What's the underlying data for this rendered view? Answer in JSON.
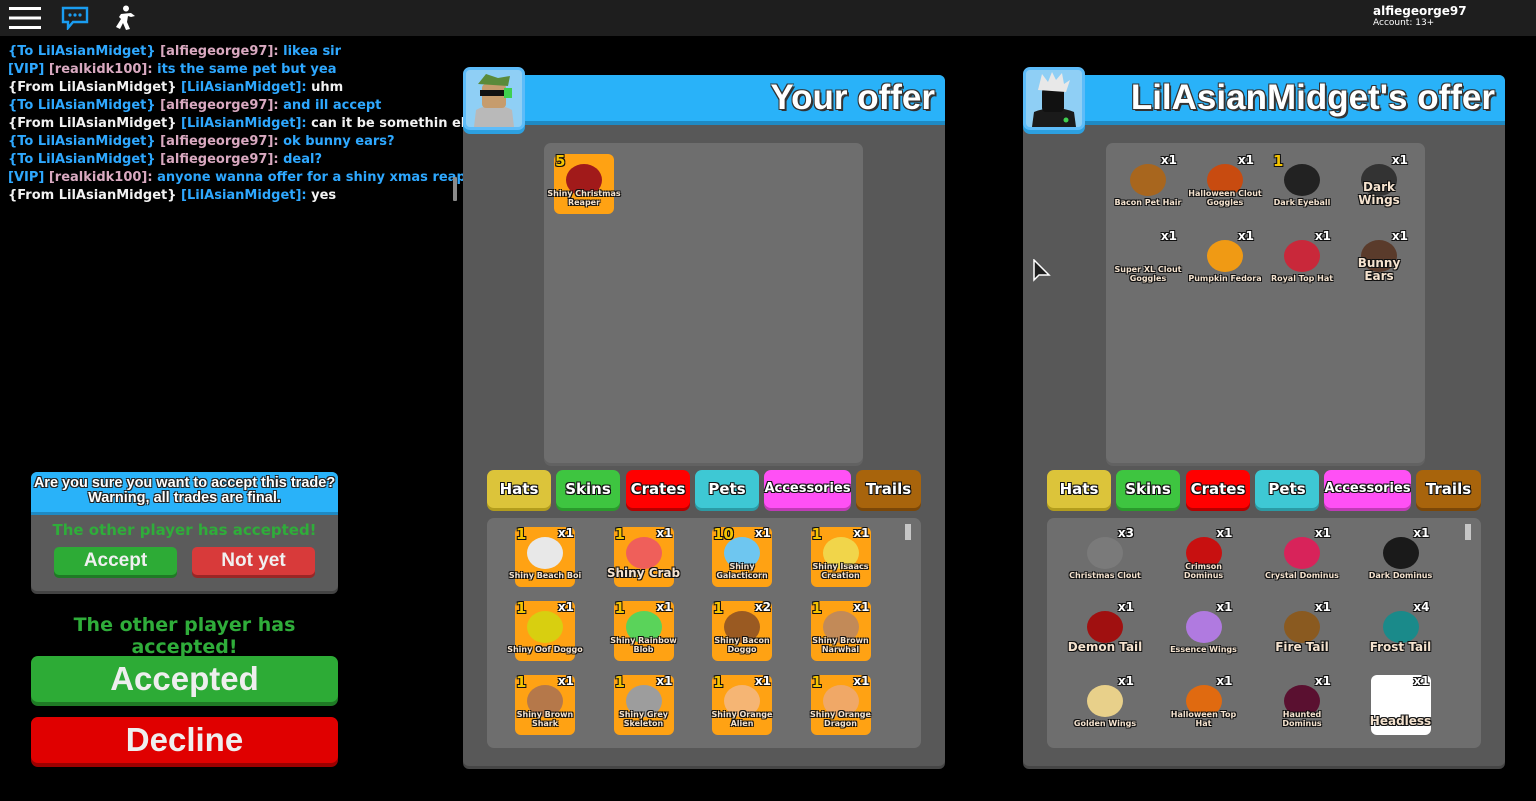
{
  "topbar": {
    "icons": [
      "menu-icon",
      "chat-icon",
      "emote-icon"
    ],
    "account_name": "alfiegeorge97",
    "account_age": "Account: 13+"
  },
  "chat": {
    "messages": [
      {
        "prefix": "{To LilAsianMidget}",
        "user": "[alfiegeorge97]:",
        "text": " likea sir",
        "prefix_color": "#2ea8ff",
        "user_color": "#d9a9c0",
        "text_color": "#2ea8ff"
      },
      {
        "prefix": "[VIP]",
        "user": "[realkidk100]:",
        "text": " its the same pet but yea",
        "prefix_color": "#2ea8ff",
        "user_color": "#d9a9c0",
        "text_color": "#2ea8ff"
      },
      {
        "prefix": "{From LilAsianMidget}",
        "user": "[LilAsianMidget]:",
        "text": "uhm",
        "prefix_color": "#f2f2f2",
        "user_color": "#2ea8ff",
        "text_color": "#f2f2f2"
      },
      {
        "prefix": "{To LilAsianMidget}",
        "user": "[alfiegeorge97]:",
        "text": " and ill accept",
        "prefix_color": "#2ea8ff",
        "user_color": "#d9a9c0",
        "text_color": "#2ea8ff"
      },
      {
        "prefix": "{From LilAsianMidget}",
        "user": "[LilAsianMidget]:",
        "text": "can it be somethin else",
        "prefix_color": "#f2f2f2",
        "user_color": "#2ea8ff",
        "text_color": "#f2f2f2"
      },
      {
        "prefix": "{To LilAsianMidget}",
        "user": "[alfiegeorge97]:",
        "text": " ok bunny ears?",
        "prefix_color": "#2ea8ff",
        "user_color": "#d9a9c0",
        "text_color": "#2ea8ff"
      },
      {
        "prefix": "{To LilAsianMidget}",
        "user": "[alfiegeorge97]:",
        "text": " deal?",
        "prefix_color": "#2ea8ff",
        "user_color": "#d9a9c0",
        "text_color": "#2ea8ff"
      },
      {
        "prefix": "[VIP]",
        "user": "[realkidk100]:",
        "text": " anyone wanna offer for a shiny xmas reaper",
        "prefix_color": "#2ea8ff",
        "user_color": "#d9a9c0",
        "text_color": "#2ea8ff"
      },
      {
        "prefix": "{From LilAsianMidget}",
        "user": "[LilAsianMidget]:",
        "text": "yes",
        "prefix_color": "#f2f2f2",
        "user_color": "#2ea8ff",
        "text_color": "#f2f2f2"
      }
    ]
  },
  "confirm": {
    "question": "Are you sure you want to accept this trade? Warning, all trades are final.",
    "status": "The other player has accepted!",
    "accept_label": "Accept",
    "notyet_label": "Not yet"
  },
  "trade": {
    "status": "The other player has accepted!",
    "accepted_label": "Accepted",
    "decline_label": "Decline"
  },
  "tabs": [
    "Hats",
    "Skins",
    "Crates",
    "Pets",
    "Accessories",
    "Trails"
  ],
  "your_offer": {
    "title": "Your offer",
    "items": [
      {
        "name": "Shiny Christmas Reaper",
        "level": "5",
        "qty": "",
        "bg": "orange",
        "art": "#a11a1a"
      }
    ],
    "inventory": [
      {
        "name": "Shiny Beach Boi",
        "level": "1",
        "qty": "x1",
        "art": "#e8e8e8"
      },
      {
        "name": "Shiny Crab",
        "level": "1",
        "qty": "x1",
        "art": "#ef5f5a",
        "big": true
      },
      {
        "name": "Shiny Galacticorn",
        "level": "10",
        "qty": "x1",
        "art": "#6ec6f0"
      },
      {
        "name": "Shiny Isaacs Creation",
        "level": "1",
        "qty": "x1",
        "art": "#f1d54a"
      },
      {
        "name": "Shiny Oof Doggo",
        "level": "1",
        "qty": "x1",
        "art": "#d8cf10"
      },
      {
        "name": "Shiny Rainbow Blob",
        "level": "1",
        "qty": "x1",
        "art": "#5ad35a"
      },
      {
        "name": "Shiny Bacon Doggo",
        "level": "1",
        "qty": "x2",
        "art": "#9a5a22"
      },
      {
        "name": "Shiny Brown Narwhal",
        "level": "1",
        "qty": "x1",
        "art": "#c28a58"
      },
      {
        "name": "Shiny Brown Shark",
        "level": "1",
        "qty": "x1",
        "art": "#b5784a"
      },
      {
        "name": "Shiny Grey Skeleton",
        "level": "1",
        "qty": "x1",
        "art": "#9d9d9d"
      },
      {
        "name": "Shiny Orange Alien",
        "level": "1",
        "qty": "x1",
        "art": "#f5b574"
      },
      {
        "name": "Shiny Orange Dragon",
        "level": "1",
        "qty": "x1",
        "art": "#f0a867"
      }
    ]
  },
  "their_offer": {
    "title": "LilAsianMidget's offer",
    "items": [
      {
        "name": "Bacon Pet Hair",
        "level": "",
        "qty": "x1",
        "art": "#a8661e"
      },
      {
        "name": "Halloween Clout Goggles",
        "level": "",
        "qty": "x1",
        "art": "#c84b10"
      },
      {
        "name": "Dark Eyeball",
        "level": "1",
        "qty": "",
        "art": "#222"
      },
      {
        "name": "Dark Wings",
        "level": "",
        "qty": "x1",
        "art": "#333",
        "big": true
      },
      {
        "name": "Super XL Clout Goggles",
        "level": "",
        "qty": "x1",
        "art": ""
      },
      {
        "name": "Pumpkin Fedora",
        "level": "",
        "qty": "x1",
        "art": "#f09a14"
      },
      {
        "name": "Royal Top Hat",
        "level": "",
        "qty": "x1",
        "art": "#c9283a"
      },
      {
        "name": "Bunny Ears",
        "level": "",
        "qty": "x1",
        "art": "#5a3b2b",
        "big": true
      }
    ],
    "inventory": [
      {
        "name": "Christmas Clout",
        "level": "",
        "qty": "x3",
        "art": "#7a7a7a"
      },
      {
        "name": "Crimson Dominus",
        "level": "",
        "qty": "x1",
        "art": "#c81010"
      },
      {
        "name": "Crystal Dominus",
        "level": "",
        "qty": "x1",
        "art": "#d8235a"
      },
      {
        "name": "Dark Dominus",
        "level": "",
        "qty": "x1",
        "art": "#1a1a1a"
      },
      {
        "name": "Demon Tail",
        "level": "",
        "qty": "x1",
        "art": "#a01010",
        "big": true
      },
      {
        "name": "Essence Wings",
        "level": "",
        "qty": "x1",
        "art": "#b07ae0"
      },
      {
        "name": "Fire Tail",
        "level": "",
        "qty": "x1",
        "art": "#8a5a20",
        "big": true
      },
      {
        "name": "Frost Tail",
        "level": "",
        "qty": "x4",
        "art": "#1a8a8a",
        "big": true
      },
      {
        "name": "Golden Wings",
        "level": "",
        "qty": "x1",
        "art": "#e8d08a"
      },
      {
        "name": "Halloween Top Hat",
        "level": "",
        "qty": "x1",
        "art": "#e06a10"
      },
      {
        "name": "Haunted Dominus",
        "level": "",
        "qty": "x1",
        "art": "#5a1030"
      },
      {
        "name": "Headless",
        "level": "",
        "qty": "x1",
        "art": "",
        "bg": "white",
        "big": true
      }
    ]
  }
}
